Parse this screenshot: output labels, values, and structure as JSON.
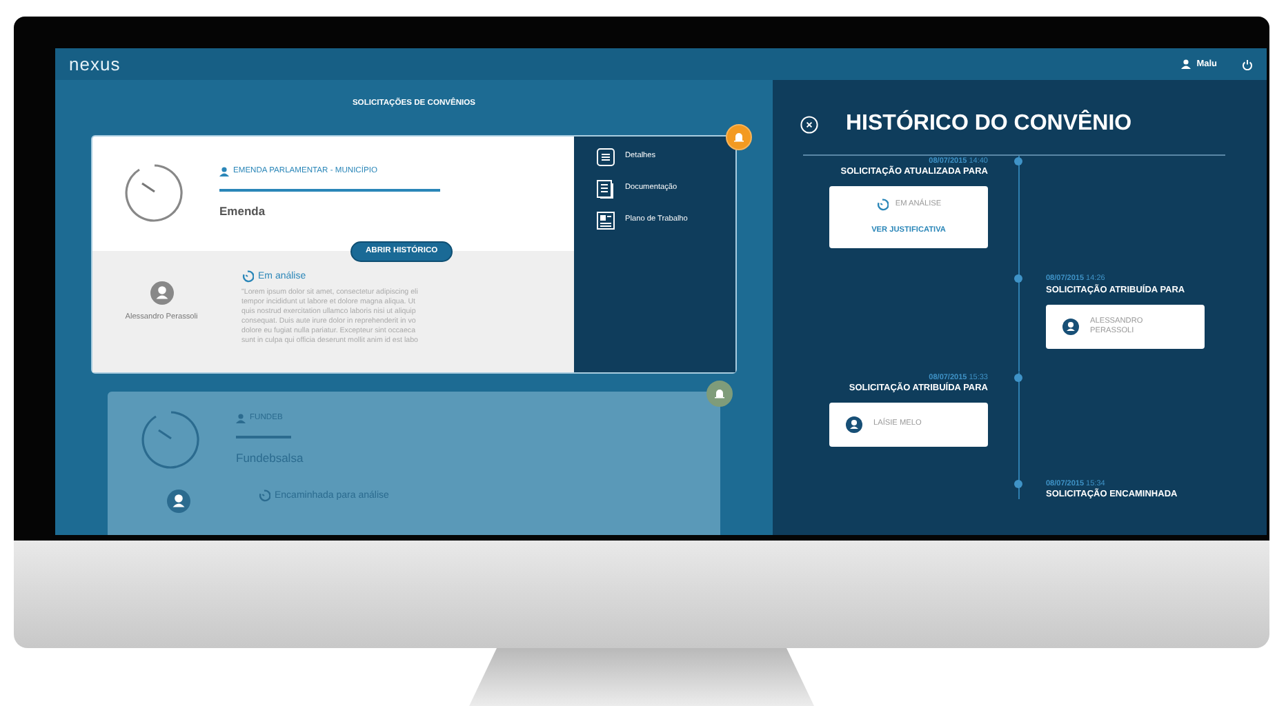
{
  "header": {
    "logo": "nexus",
    "user": "Malu"
  },
  "list_title": "SOLICITAÇÕES DE CONVÊNIOS",
  "cards": [
    {
      "faded": false,
      "category": "EMENDA PARLAMENTAR - MUNICÍPIO",
      "name": "Emenda",
      "button": "ABRIR HISTÓRICO",
      "person": "Alessandro Perassoli",
      "status": "Em análise",
      "description_lines": [
        "\"Lorem ipsum dolor sit amet, consectetur adipiscing eli",
        "tempor incididunt ut labore et dolore magna aliqua. Ut",
        "quis nostrud exercitation ullamco laboris nisi ut aliquip",
        "consequat. Duis aute irure dolor in reprehenderit in vo",
        "dolore eu fugiat nulla pariatur. Excepteur sint occaeca",
        "sunt in culpa qui officia deserunt mollit anim id est labo"
      ],
      "menu": [
        {
          "kind": "details",
          "label": "Detalhes"
        },
        {
          "kind": "documents",
          "label": "Documentação"
        },
        {
          "kind": "plan",
          "label": "Plano de Trabalho"
        }
      ]
    },
    {
      "faded": true,
      "category": "FUNDEB",
      "name": "Fundebsalsa",
      "status": "Encaminhada para análise"
    }
  ],
  "history": {
    "title": "HISTÓRICO DO CONVÊNIO",
    "events": [
      {
        "kind": "left",
        "date": "08/07/2015",
        "time": "14:40",
        "title": "SOLICITAÇÃO ATUALIZADA PARA",
        "card": {
          "kind": "status",
          "text": "EM ANÁLISE",
          "link": "VER JUSTIFICATIVA"
        }
      },
      {
        "kind": "right",
        "date": "08/07/2015",
        "time": "14:26",
        "title": "SOLICITAÇÃO ATRIBUÍDA PARA",
        "card": {
          "kind": "person",
          "text": "ALESSANDRO PERASSOLI"
        }
      },
      {
        "kind": "left",
        "date": "08/07/2015",
        "time": "15:33",
        "title": "SOLICITAÇÃO ATRIBUÍDA PARA",
        "card": {
          "kind": "person",
          "text": "LAÍSIE MELO"
        }
      },
      {
        "kind": "right",
        "date": "08/07/2015",
        "time": "15:34",
        "title": "SOLICITAÇÃO ENCAMINHADA"
      }
    ]
  }
}
